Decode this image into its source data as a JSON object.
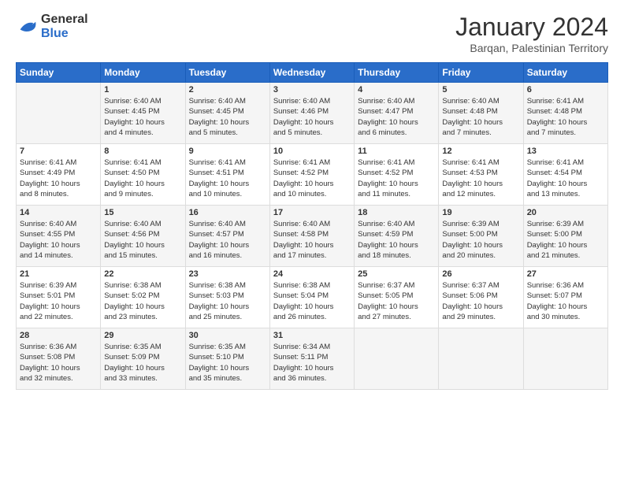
{
  "logo": {
    "general": "General",
    "blue": "Blue"
  },
  "title": "January 2024",
  "subtitle": "Barqan, Palestinian Territory",
  "headers": [
    "Sunday",
    "Monday",
    "Tuesday",
    "Wednesday",
    "Thursday",
    "Friday",
    "Saturday"
  ],
  "weeks": [
    [
      {
        "day": "",
        "info": ""
      },
      {
        "day": "1",
        "info": "Sunrise: 6:40 AM\nSunset: 4:45 PM\nDaylight: 10 hours\nand 4 minutes."
      },
      {
        "day": "2",
        "info": "Sunrise: 6:40 AM\nSunset: 4:45 PM\nDaylight: 10 hours\nand 5 minutes."
      },
      {
        "day": "3",
        "info": "Sunrise: 6:40 AM\nSunset: 4:46 PM\nDaylight: 10 hours\nand 5 minutes."
      },
      {
        "day": "4",
        "info": "Sunrise: 6:40 AM\nSunset: 4:47 PM\nDaylight: 10 hours\nand 6 minutes."
      },
      {
        "day": "5",
        "info": "Sunrise: 6:40 AM\nSunset: 4:48 PM\nDaylight: 10 hours\nand 7 minutes."
      },
      {
        "day": "6",
        "info": "Sunrise: 6:41 AM\nSunset: 4:48 PM\nDaylight: 10 hours\nand 7 minutes."
      }
    ],
    [
      {
        "day": "7",
        "info": "Sunrise: 6:41 AM\nSunset: 4:49 PM\nDaylight: 10 hours\nand 8 minutes."
      },
      {
        "day": "8",
        "info": "Sunrise: 6:41 AM\nSunset: 4:50 PM\nDaylight: 10 hours\nand 9 minutes."
      },
      {
        "day": "9",
        "info": "Sunrise: 6:41 AM\nSunset: 4:51 PM\nDaylight: 10 hours\nand 10 minutes."
      },
      {
        "day": "10",
        "info": "Sunrise: 6:41 AM\nSunset: 4:52 PM\nDaylight: 10 hours\nand 10 minutes."
      },
      {
        "day": "11",
        "info": "Sunrise: 6:41 AM\nSunset: 4:52 PM\nDaylight: 10 hours\nand 11 minutes."
      },
      {
        "day": "12",
        "info": "Sunrise: 6:41 AM\nSunset: 4:53 PM\nDaylight: 10 hours\nand 12 minutes."
      },
      {
        "day": "13",
        "info": "Sunrise: 6:41 AM\nSunset: 4:54 PM\nDaylight: 10 hours\nand 13 minutes."
      }
    ],
    [
      {
        "day": "14",
        "info": "Sunrise: 6:40 AM\nSunset: 4:55 PM\nDaylight: 10 hours\nand 14 minutes."
      },
      {
        "day": "15",
        "info": "Sunrise: 6:40 AM\nSunset: 4:56 PM\nDaylight: 10 hours\nand 15 minutes."
      },
      {
        "day": "16",
        "info": "Sunrise: 6:40 AM\nSunset: 4:57 PM\nDaylight: 10 hours\nand 16 minutes."
      },
      {
        "day": "17",
        "info": "Sunrise: 6:40 AM\nSunset: 4:58 PM\nDaylight: 10 hours\nand 17 minutes."
      },
      {
        "day": "18",
        "info": "Sunrise: 6:40 AM\nSunset: 4:59 PM\nDaylight: 10 hours\nand 18 minutes."
      },
      {
        "day": "19",
        "info": "Sunrise: 6:39 AM\nSunset: 5:00 PM\nDaylight: 10 hours\nand 20 minutes."
      },
      {
        "day": "20",
        "info": "Sunrise: 6:39 AM\nSunset: 5:00 PM\nDaylight: 10 hours\nand 21 minutes."
      }
    ],
    [
      {
        "day": "21",
        "info": "Sunrise: 6:39 AM\nSunset: 5:01 PM\nDaylight: 10 hours\nand 22 minutes."
      },
      {
        "day": "22",
        "info": "Sunrise: 6:38 AM\nSunset: 5:02 PM\nDaylight: 10 hours\nand 23 minutes."
      },
      {
        "day": "23",
        "info": "Sunrise: 6:38 AM\nSunset: 5:03 PM\nDaylight: 10 hours\nand 25 minutes."
      },
      {
        "day": "24",
        "info": "Sunrise: 6:38 AM\nSunset: 5:04 PM\nDaylight: 10 hours\nand 26 minutes."
      },
      {
        "day": "25",
        "info": "Sunrise: 6:37 AM\nSunset: 5:05 PM\nDaylight: 10 hours\nand 27 minutes."
      },
      {
        "day": "26",
        "info": "Sunrise: 6:37 AM\nSunset: 5:06 PM\nDaylight: 10 hours\nand 29 minutes."
      },
      {
        "day": "27",
        "info": "Sunrise: 6:36 AM\nSunset: 5:07 PM\nDaylight: 10 hours\nand 30 minutes."
      }
    ],
    [
      {
        "day": "28",
        "info": "Sunrise: 6:36 AM\nSunset: 5:08 PM\nDaylight: 10 hours\nand 32 minutes."
      },
      {
        "day": "29",
        "info": "Sunrise: 6:35 AM\nSunset: 5:09 PM\nDaylight: 10 hours\nand 33 minutes."
      },
      {
        "day": "30",
        "info": "Sunrise: 6:35 AM\nSunset: 5:10 PM\nDaylight: 10 hours\nand 35 minutes."
      },
      {
        "day": "31",
        "info": "Sunrise: 6:34 AM\nSunset: 5:11 PM\nDaylight: 10 hours\nand 36 minutes."
      },
      {
        "day": "",
        "info": ""
      },
      {
        "day": "",
        "info": ""
      },
      {
        "day": "",
        "info": ""
      }
    ]
  ]
}
